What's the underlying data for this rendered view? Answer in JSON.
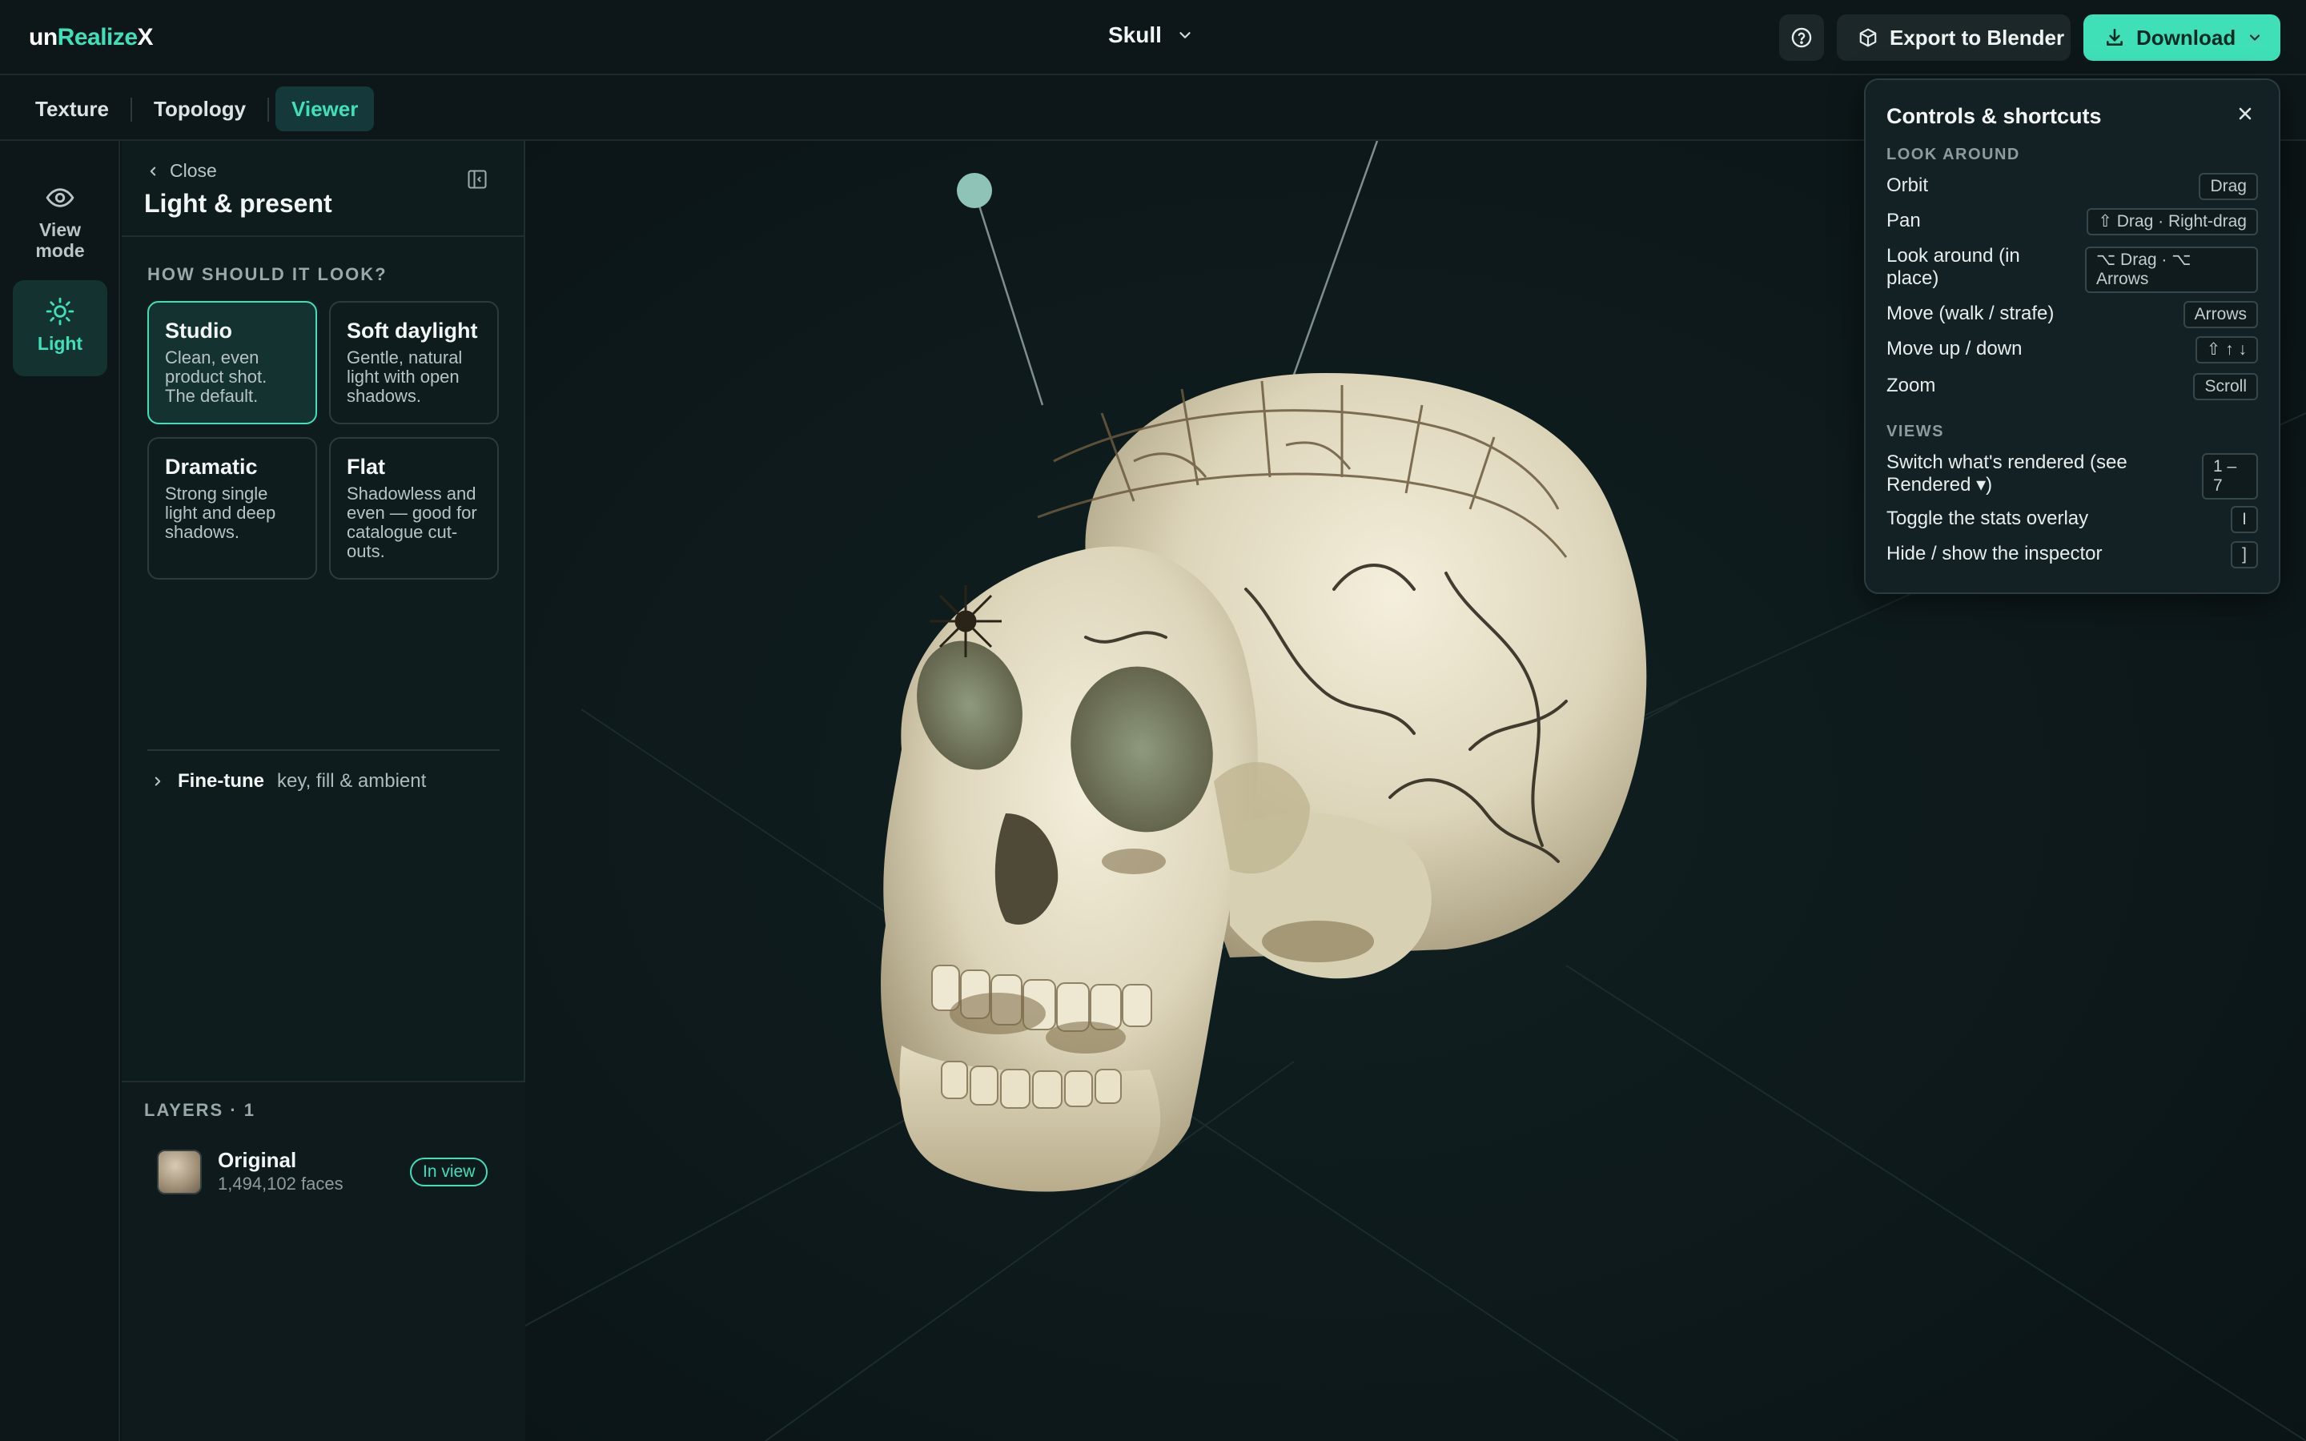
{
  "app": {
    "logo_parts": [
      "un",
      "Realize",
      "X"
    ],
    "project_name": "Skull"
  },
  "header": {
    "export_label": "Export to Blender",
    "download_label": "Download"
  },
  "tabs": [
    {
      "label": "Texture",
      "active": false
    },
    {
      "label": "Topology",
      "active": false
    },
    {
      "label": "Viewer",
      "active": true
    }
  ],
  "rail": [
    {
      "label": "View mode",
      "icon": "eye-icon",
      "active": false
    },
    {
      "label": "Light",
      "icon": "sun-icon",
      "active": true
    }
  ],
  "panel": {
    "close_label": "Close",
    "title": "Light & present",
    "section_label": "HOW SHOULD IT LOOK?",
    "presets": [
      {
        "title": "Studio",
        "desc": "Clean, even product shot. The default.",
        "selected": true
      },
      {
        "title": "Soft daylight",
        "desc": "Gentle, natural light with open shadows.",
        "selected": false
      },
      {
        "title": "Dramatic",
        "desc": "Strong single light and deep shadows.",
        "selected": false
      },
      {
        "title": "Flat",
        "desc": "Shadowless and even — good for catalogue cut-outs.",
        "selected": false
      }
    ],
    "finetune_title": "Fine-tune",
    "finetune_desc": "key, fill & ambient"
  },
  "layers": {
    "label": "LAYERS · 1",
    "items": [
      {
        "name": "Original",
        "faces": "1,494,102 faces",
        "badge": "In view"
      }
    ]
  },
  "controls": {
    "title": "Controls & shortcuts",
    "sections": [
      {
        "label": "LOOK AROUND",
        "rows": [
          {
            "label": "Orbit",
            "key": "Drag"
          },
          {
            "label": "Pan",
            "key": "⇧ Drag · Right-drag"
          },
          {
            "label": "Look around (in place)",
            "key": "⌥ Drag · ⌥ Arrows"
          },
          {
            "label": "Move (walk / strafe)",
            "key": "Arrows"
          },
          {
            "label": "Move up / down",
            "key": "⇧ ↑ ↓"
          },
          {
            "label": "Zoom",
            "key": "Scroll"
          }
        ]
      },
      {
        "label": "VIEWS",
        "rows": [
          {
            "label": "Switch what's rendered (see Rendered ▾)",
            "key": "1 – 7"
          },
          {
            "label": "Toggle the stats overlay",
            "key": "I"
          },
          {
            "label": "Hide / show the inspector",
            "key": "]"
          }
        ]
      }
    ]
  },
  "colors": {
    "accent": "#3fe0b8",
    "background": "#0b1416",
    "panel": "#0f1c1e"
  }
}
